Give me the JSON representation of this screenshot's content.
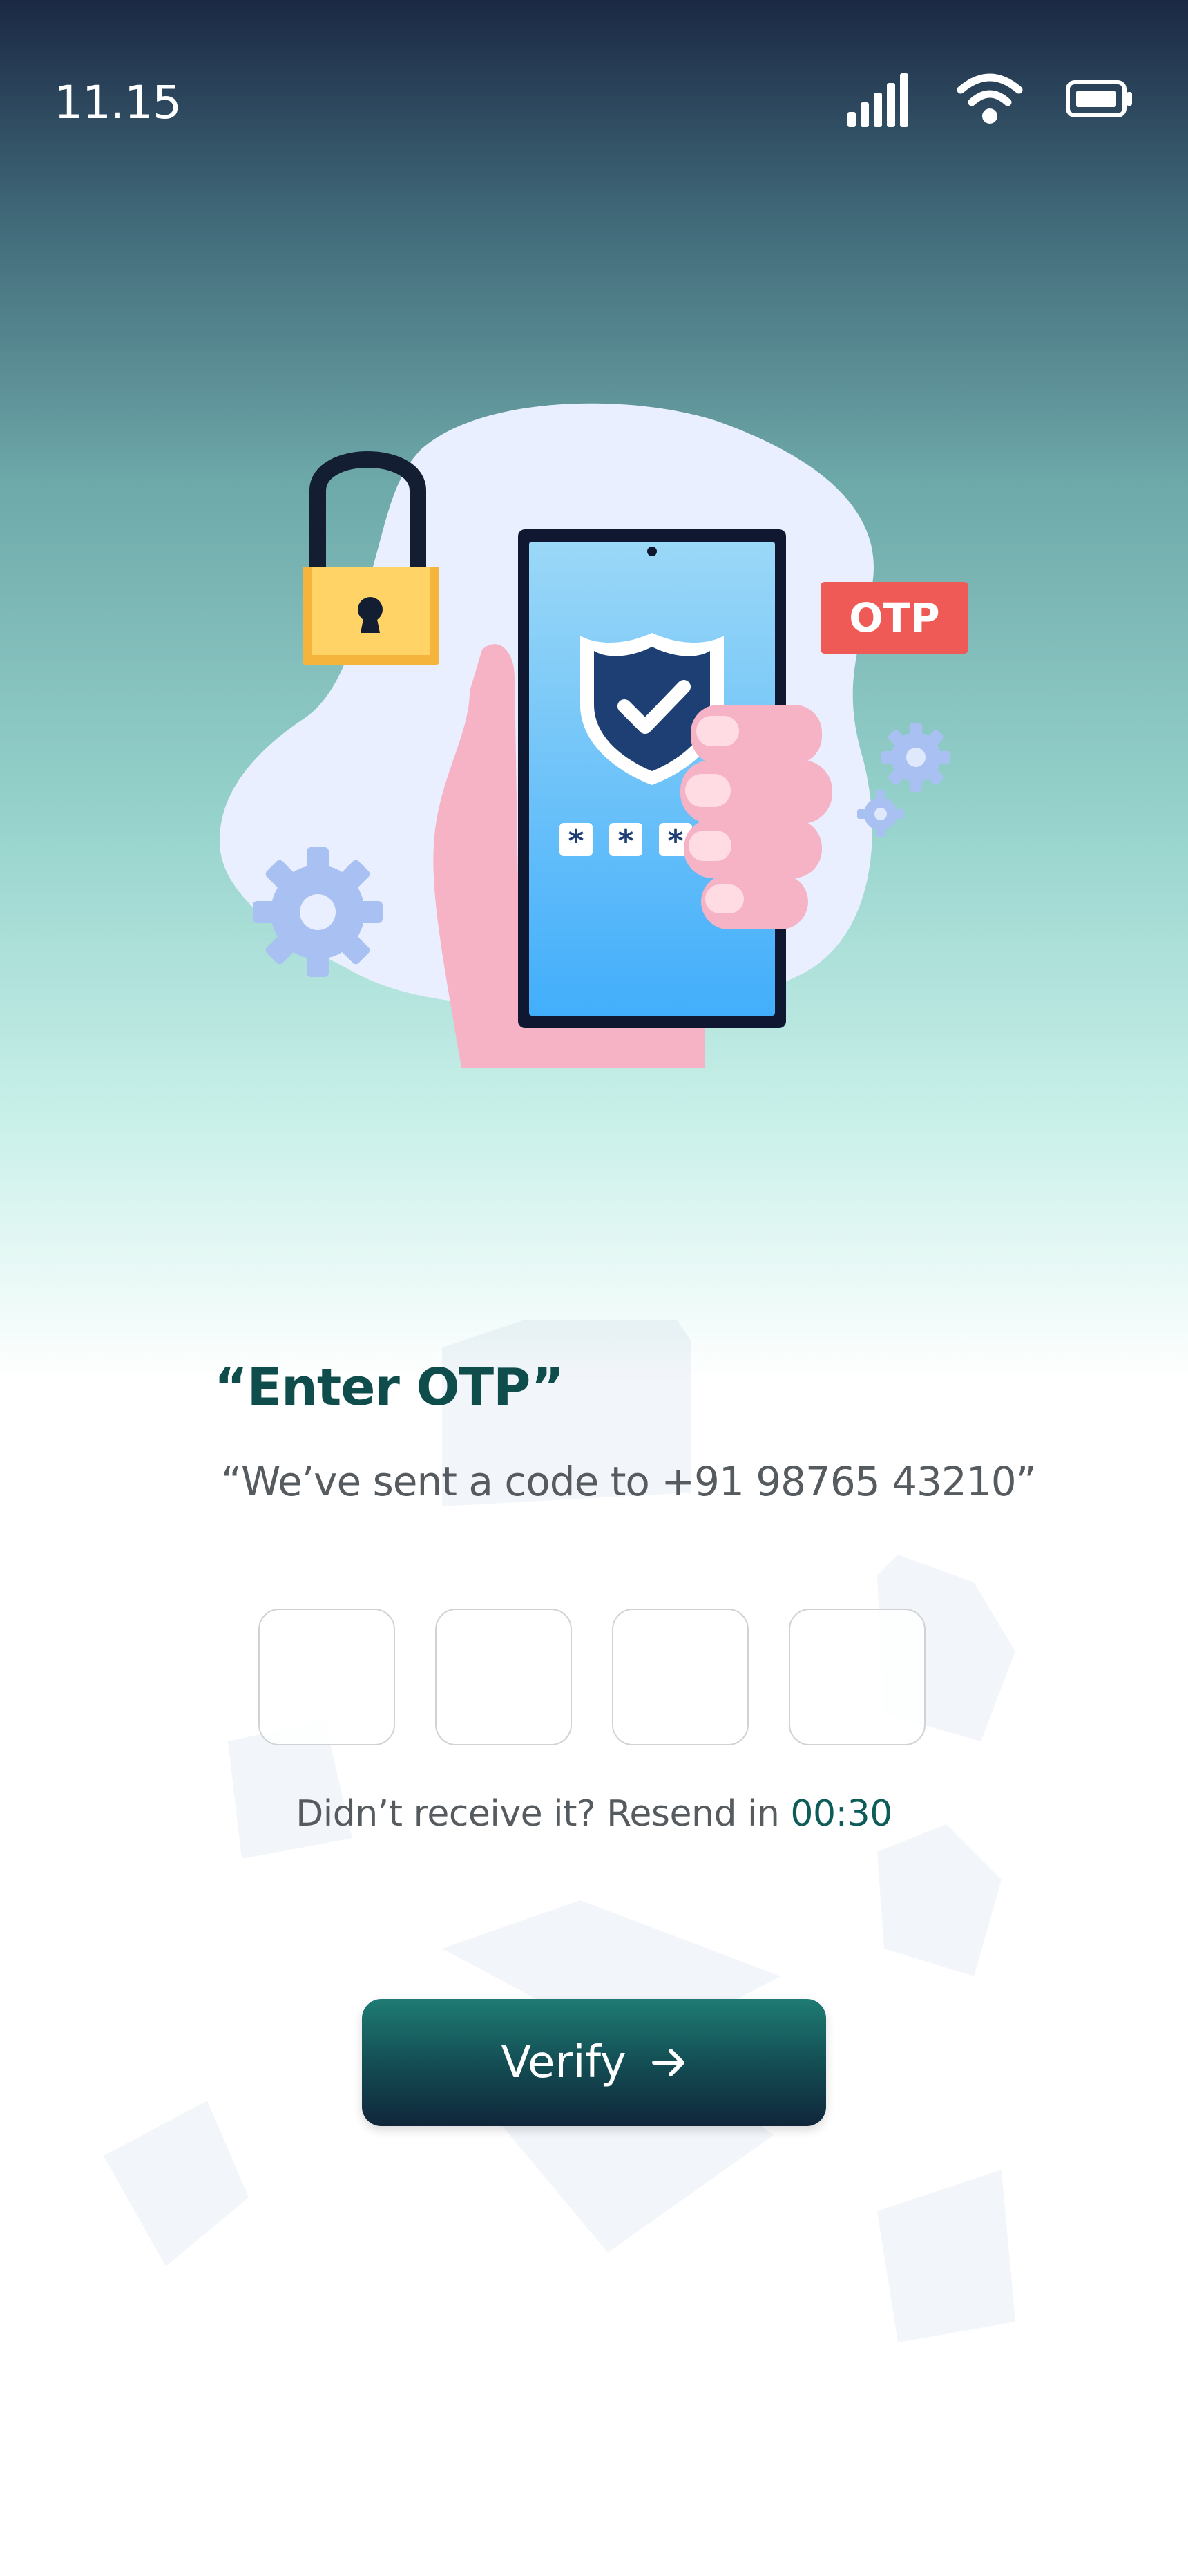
{
  "status_bar": {
    "time": "11.15",
    "icons": [
      "signal-icon",
      "wifi-icon",
      "battery-icon"
    ]
  },
  "illustration": {
    "badge_text": "OTP",
    "masked_code": [
      "*",
      "*",
      "*"
    ],
    "icons": [
      "padlock-icon",
      "shield-check-icon",
      "gear-icon"
    ]
  },
  "screen": {
    "title": "“Enter OTP”",
    "subtitle": "“We’ve sent a code to +91 98765 43210”",
    "otp_digits": [
      "",
      "",
      "",
      ""
    ],
    "resend_prefix": "Didn’t receive it? Resend in",
    "resend_timer": "00:30",
    "verify_label": "Verify",
    "verify_icon": "arrow-right-icon"
  },
  "colors": {
    "accent": "#0e5c5a",
    "title": "#0f4c4c",
    "otp_badge": "#ef5a56",
    "shield": "#1e3f73",
    "phone_screen": "#5fbcf6",
    "hand": "#f6b3c6",
    "padlock": "#ffc94a"
  }
}
